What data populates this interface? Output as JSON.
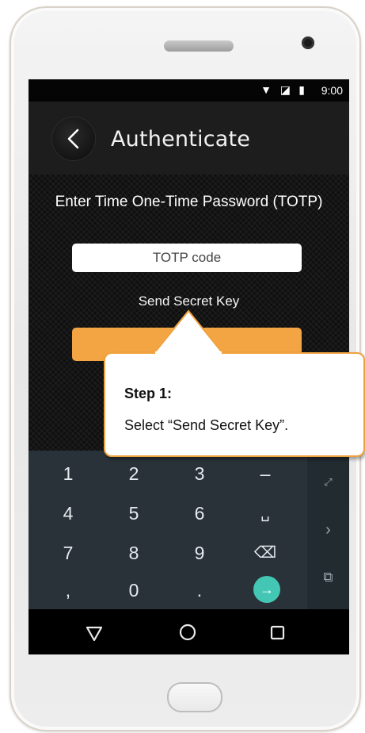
{
  "status": {
    "time": "9:00"
  },
  "app_bar": {
    "title": "Authenticate"
  },
  "main": {
    "prompt": "Enter Time One-Time Password (TOTP)",
    "totp_placeholder": "TOTP code",
    "send_secret_label": "Send Secret Key"
  },
  "keyboard": {
    "rows": [
      [
        "1",
        "2",
        "3",
        "–"
      ],
      [
        "4",
        "5",
        "6",
        "␣"
      ],
      [
        "7",
        "8",
        "9",
        "⌫"
      ],
      [
        ",",
        "0",
        ".",
        "→"
      ]
    ]
  },
  "tooltip": {
    "title": "Step 1:",
    "text": "Select “Send Secret Key”."
  },
  "colors": {
    "accent": "#F3A544",
    "keyboard_bg": "#283238",
    "go_key": "#43C6B4"
  }
}
